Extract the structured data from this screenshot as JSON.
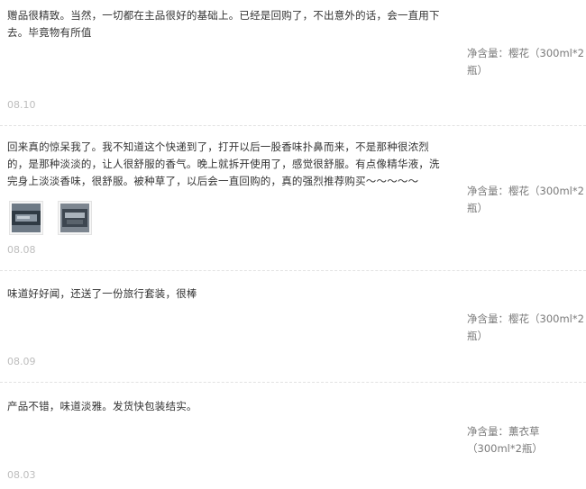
{
  "reviews": [
    {
      "text": "赠品很精致。当然，一切都在主品很好的基础上。已经是回购了，不出意外的话，会一直用下去。毕竟物有所值",
      "spec_label": "净含量：",
      "spec_value": "樱花（300ml*2瓶）",
      "date": "08.10"
    },
    {
      "text": "回来真的惊呆我了。我不知道这个快递到了，打开以后一股香味扑鼻而来，不是那种很浓烈的，是那种淡淡的，让人很舒服的香气。晚上就拆开使用了，感觉很舒服。有点像精华液，洗完身上淡淡香味，很舒服。被种草了，以后会一直回购的，真的强烈推荐购买～～～～～",
      "spec_label": "净含量：",
      "spec_value": "樱花（300ml*2瓶）",
      "date": "08.08",
      "photos": [
        "photo-1",
        "photo-2"
      ]
    },
    {
      "text": "味道好好闻，还送了一份旅行套装，很棒",
      "spec_label": "净含量：",
      "spec_value": "樱花（300ml*2瓶）",
      "date": "08.09"
    },
    {
      "text": "产品不错，味道淡雅。发货快包装结实。",
      "spec_label": "净含量：",
      "spec_value": "薰衣草（300ml*2瓶）",
      "date": "08.03"
    }
  ]
}
